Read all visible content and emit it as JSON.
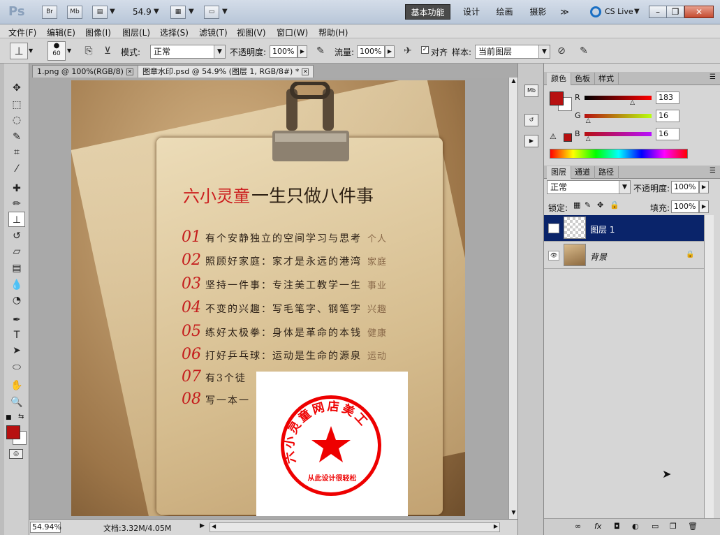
{
  "app": {
    "logo": "Ps"
  },
  "titlebar": {
    "bridge_label": "Br",
    "minibridge_label": "Mb",
    "zoom_value": "54.9",
    "workspaces": [
      "基本功能",
      "设计",
      "绘画",
      "摄影"
    ],
    "more_label": "≫",
    "cslive_label": "CS Live"
  },
  "menu": [
    "文件(F)",
    "编辑(E)",
    "图像(I)",
    "图层(L)",
    "选择(S)",
    "滤镜(T)",
    "视图(V)",
    "窗口(W)",
    "帮助(H)"
  ],
  "options": {
    "brush_size": "60",
    "mode_label": "模式:",
    "mode_value": "正常",
    "opacity_label": "不透明度:",
    "opacity_value": "100%",
    "flow_label": "流量:",
    "flow_value": "100%",
    "aligned_label": "对齐",
    "sample_label": "样本:",
    "sample_value": "当前图层"
  },
  "tabs": [
    {
      "label": "1.png @ 100%(RGB/8)",
      "active": false
    },
    {
      "label": "图章水印.psd @ 54.9% (图层 1, RGB/8#) *",
      "active": true
    }
  ],
  "status": {
    "zoom": "54.94%",
    "doc_info": "文档:3.32M/4.05M"
  },
  "artwork": {
    "heading_red": "六小灵童",
    "heading_dark": "一生只做八件事",
    "items": [
      {
        "num": "01",
        "text": "有个安静独立的空间学习与思考",
        "side": "个人"
      },
      {
        "num": "02",
        "text": "照顾好家庭：家才是永远的港湾",
        "side": "家庭"
      },
      {
        "num": "03",
        "text": "坚持一件事：专注美工教学一生",
        "side": "事业"
      },
      {
        "num": "04",
        "text": "不变的兴趣：写毛笔字、钢笔字",
        "side": "兴趣"
      },
      {
        "num": "05",
        "text": "练好太极拳：身体是革命的本钱",
        "side": "健康"
      },
      {
        "num": "06",
        "text": "打好乒乓球：运动是生命的源泉",
        "side": "运动"
      },
      {
        "num": "07",
        "text": "有3个徒",
        "side": ""
      },
      {
        "num": "08",
        "text": "写一本一",
        "side": ""
      }
    ],
    "stamp_top": "六小灵童网店美工",
    "stamp_bottom": "从此设计很轻松"
  },
  "color_panel": {
    "tabs": [
      "颜色",
      "色板",
      "样式"
    ],
    "r": {
      "label": "R",
      "value": "183",
      "fraction": 0.72
    },
    "g": {
      "label": "G",
      "value": "16",
      "fraction": 0.06
    },
    "b": {
      "label": "B",
      "value": "16",
      "fraction": 0.06
    },
    "fg_color": "#b71010"
  },
  "layers_panel": {
    "tabs": [
      "图层",
      "通道",
      "路径"
    ],
    "blend_mode": "正常",
    "opacity_label": "不透明度:",
    "opacity_value": "100%",
    "lock_label": "锁定:",
    "fill_label": "填充:",
    "fill_value": "100%",
    "layers": [
      {
        "name": "图层 1",
        "selected": true,
        "locked": false
      },
      {
        "name": "背景",
        "selected": false,
        "locked": true
      }
    ]
  }
}
